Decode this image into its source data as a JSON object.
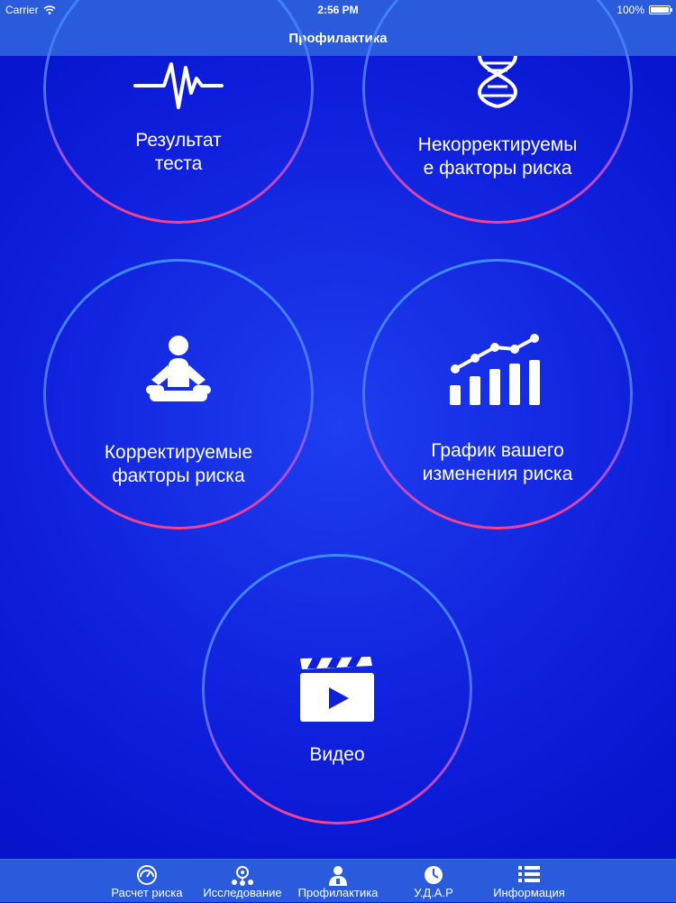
{
  "status_bar": {
    "carrier": "Carrier",
    "time": "2:56 PM",
    "battery": "100%"
  },
  "navbar": {
    "title": "Профилактика"
  },
  "circles": [
    {
      "label": "Результат\nтеста",
      "icon": "heartbeat-icon"
    },
    {
      "label": "Некорректируемы\nе факторы риска",
      "icon": "dna-icon"
    },
    {
      "label": "Корректируемые\nфакторы риска",
      "icon": "meditation-icon"
    },
    {
      "label": "График вашего\nизменения риска",
      "icon": "growth-chart-icon"
    },
    {
      "label": "Видео",
      "icon": "video-clapper-icon"
    }
  ],
  "tabs": [
    {
      "label": "Расчет риска",
      "icon": "gauge-icon"
    },
    {
      "label": "Исследование",
      "icon": "network-icon"
    },
    {
      "label": "Профилактика",
      "icon": "doctor-icon"
    },
    {
      "label": "У.Д.А.Р",
      "icon": "clock-icon"
    },
    {
      "label": "Информация",
      "icon": "list-icon"
    }
  ],
  "colors": {
    "bar": "#2a5bdc",
    "background": "#0f1fdc",
    "ring_top": "#3a8cff",
    "ring_bottom": "#ff3f86"
  }
}
